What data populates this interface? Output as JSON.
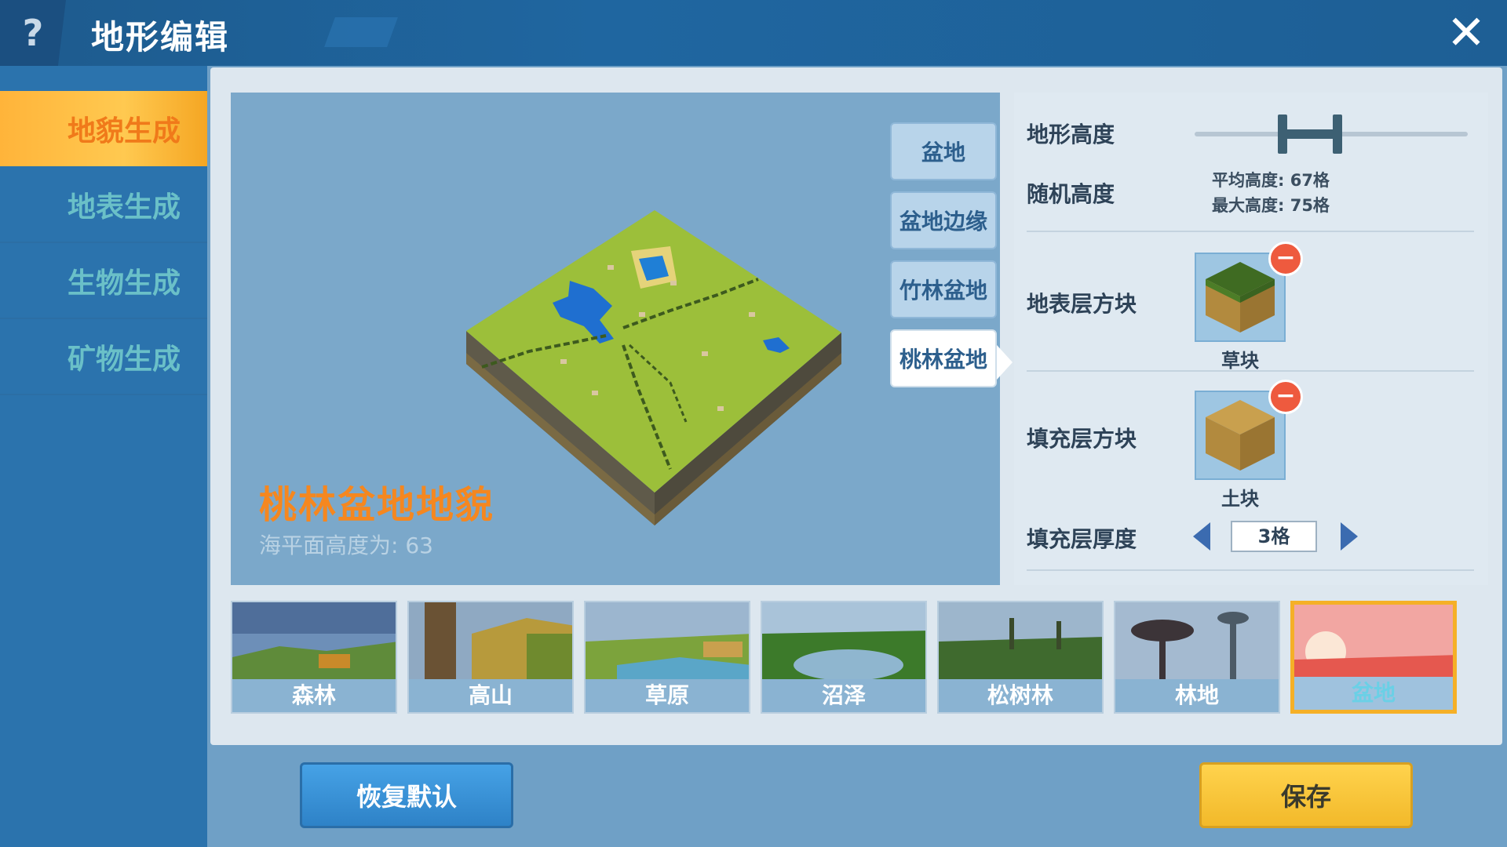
{
  "header": {
    "help_label": "?",
    "title": "地形编辑",
    "close_label": "✕"
  },
  "sidebar": {
    "items": [
      {
        "label": "地貌生成",
        "active": true
      },
      {
        "label": "地表生成",
        "active": false
      },
      {
        "label": "生物生成",
        "active": false
      },
      {
        "label": "矿物生成",
        "active": false
      }
    ]
  },
  "preview": {
    "title": "桃林盆地地貌",
    "sea_level": "海平面高度为: 63"
  },
  "subtypes": [
    {
      "label": "盆地",
      "active": false
    },
    {
      "label": "盆地边缘",
      "active": false
    },
    {
      "label": "竹林盆地",
      "active": false
    },
    {
      "label": "桃林盆地",
      "active": true
    }
  ],
  "settings": {
    "terrain_height_label": "地形高度",
    "random_height_label": "随机高度",
    "avg_height": "平均高度: 67格",
    "max_height": "最大高度: 75格",
    "surface_block_label": "地表层方块",
    "surface_block_name": "草块",
    "fill_block_label": "填充层方块",
    "fill_block_name": "土块",
    "fill_thickness_label": "填充层厚度",
    "fill_thickness_value": "3格",
    "remove_symbol": "−"
  },
  "biomes": [
    {
      "label": "森林",
      "selected": false
    },
    {
      "label": "高山",
      "selected": false
    },
    {
      "label": "草原",
      "selected": false
    },
    {
      "label": "沼泽",
      "selected": false
    },
    {
      "label": "松树林",
      "selected": false
    },
    {
      "label": "林地",
      "selected": false
    },
    {
      "label": "盆地",
      "selected": true
    }
  ],
  "footer": {
    "reset_label": "恢复默认",
    "save_label": "保存"
  },
  "colors": {
    "accent_orange": "#f5871f",
    "save_yellow": "#f2b92a",
    "reset_blue": "#2e82c7",
    "remove_red": "#ee5a3e"
  }
}
